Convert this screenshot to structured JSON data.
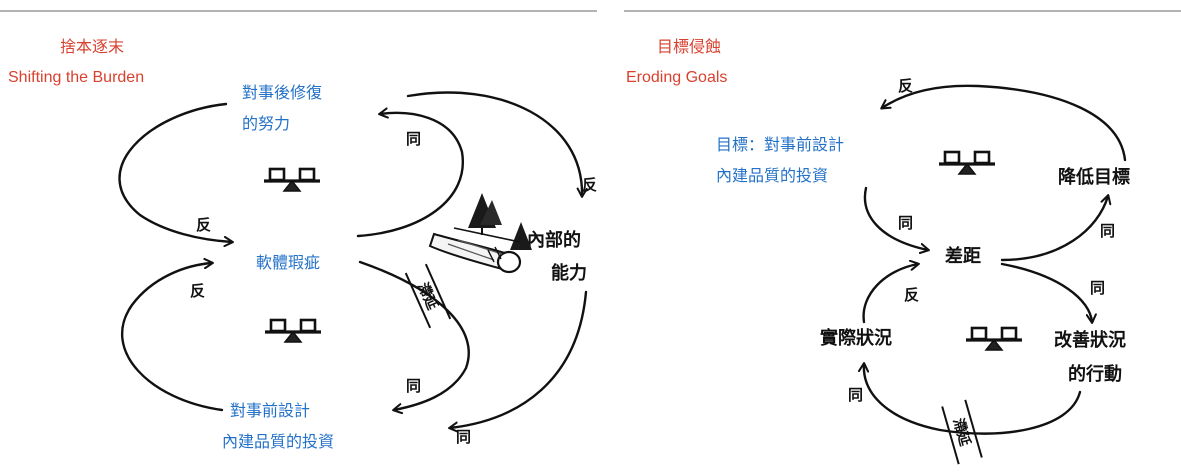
{
  "colors": {
    "title": "#d8412f",
    "label": "#2472c8",
    "ink": "#111111",
    "rule": "#9a9a9a"
  },
  "left": {
    "title_zh": "捨本逐末",
    "title_en": "Shifting the Burden",
    "label_fix": [
      "對事後修復",
      "的努力"
    ],
    "label_problem": "軟體瑕疵",
    "label_invest": [
      "對事前設計",
      "內建品質的投資"
    ],
    "node_capability": [
      "內部的",
      "能力"
    ],
    "delay": "滯延",
    "polarity": {
      "fix_to_problem": "反",
      "problem_to_fix": "同",
      "fix_to_capability": "反",
      "invest_to_problem": "反",
      "problem_to_invest": "同",
      "capability_to_invest": "同"
    }
  },
  "right": {
    "title_zh": "目標侵蝕",
    "title_en": "Eroding Goals",
    "label_goal": [
      "目標：對事前設計",
      "內建品質的投資"
    ],
    "node_lower_goal": "降低目標",
    "node_gap": "差距",
    "node_actual": "實際狀況",
    "node_action": [
      "改善狀況",
      "的行動"
    ],
    "delay": "滯延",
    "polarity": {
      "lower_to_goal": "反",
      "goal_to_gap": "同",
      "gap_to_lower": "同",
      "gap_to_action": "同",
      "actual_to_gap": "反",
      "action_to_actual": "同"
    }
  }
}
